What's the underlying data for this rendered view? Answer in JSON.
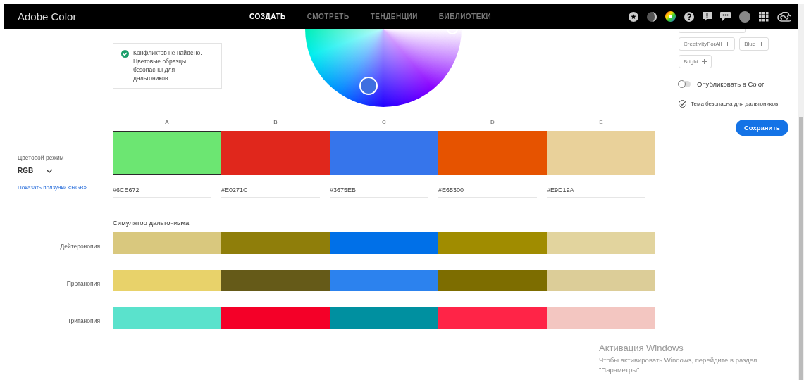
{
  "header": {
    "logo": "Adobe Color",
    "nav": [
      {
        "label": "СОЗДАТЬ",
        "selected": true
      },
      {
        "label": "СМОТРЕТЬ",
        "selected": false
      },
      {
        "label": "ТЕНДЕНЦИИ",
        "selected": false
      },
      {
        "label": "БИБЛИОТЕКИ",
        "selected": false
      }
    ]
  },
  "conflict_notice": {
    "text": "Конфликтов не найдено. Цветовые образцы безопасны для дальтоников."
  },
  "color_mode": {
    "label": "Цветовой режим",
    "value": "RGB",
    "link": "Показать ползунки «RGB»"
  },
  "swatches": [
    {
      "letter": "A",
      "color": "#6CE672",
      "hex": "#6CE672",
      "selected": true
    },
    {
      "letter": "B",
      "color": "#E0271C",
      "hex": "#E0271C",
      "selected": false
    },
    {
      "letter": "C",
      "color": "#3675EB",
      "hex": "#3675EB",
      "selected": false
    },
    {
      "letter": "D",
      "color": "#E65300",
      "hex": "#E65300",
      "selected": false
    },
    {
      "letter": "E",
      "color": "#E9D19A",
      "hex": "#E9D19A",
      "selected": false
    }
  ],
  "simulator": {
    "title": "Симулятор дальтонизма",
    "rows": [
      {
        "label": "Дейтеронопия",
        "swatches": [
          {
            "color": "#d9c87e"
          },
          {
            "color": "#8f7e0a"
          },
          {
            "color": "#0070e8"
          },
          {
            "color": "#a08c00"
          },
          {
            "color": "#e2d49e"
          }
        ]
      },
      {
        "label": "Протанопия",
        "swatches": [
          {
            "color": "#e8d26a"
          },
          {
            "color": "#655a18"
          },
          {
            "color": "#2c82ee"
          },
          {
            "color": "#7d6d00"
          },
          {
            "color": "#dccd98"
          }
        ]
      },
      {
        "label": "Тританопия",
        "swatches": [
          {
            "color": "#5ae2cc"
          },
          {
            "color": "#f40028"
          },
          {
            "color": "#0090a0"
          },
          {
            "color": "#ff2447"
          },
          {
            "color": "#f3c6c1"
          }
        ]
      }
    ]
  },
  "tags": [
    {
      "label": "CreativityForAll"
    },
    {
      "label": "Blue"
    },
    {
      "label": "Bright"
    }
  ],
  "publish": {
    "label": "Опубликовать в Color",
    "on": false
  },
  "colorblind_safe": {
    "label": "Тема безопасна для дальтоников",
    "checked": true
  },
  "save_button": "Сохранить",
  "windows_activation": {
    "title": "Активация Windows",
    "text": "Чтобы активировать Windows, перейдите в раздел \"Параметры\"."
  }
}
